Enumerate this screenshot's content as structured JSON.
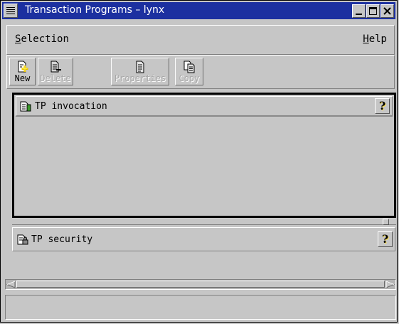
{
  "window": {
    "title": "Transaction Programs – lynx"
  },
  "menubar": {
    "selection": {
      "mnemonic": "S",
      "rest": "election"
    },
    "help": {
      "mnemonic": "H",
      "rest": "elp"
    }
  },
  "toolbar": {
    "buttons": [
      {
        "label": "New",
        "icon": "new-document-icon",
        "enabled": true
      },
      {
        "label": "Delete",
        "icon": "delete-document-icon",
        "enabled": false
      },
      {
        "label": "Properties",
        "icon": "properties-document-icon",
        "enabled": false
      },
      {
        "label": "Copy",
        "icon": "copy-document-icon",
        "enabled": false
      }
    ]
  },
  "panes": {
    "invocation": {
      "title": "TP invocation",
      "help_glyph": "?"
    },
    "security": {
      "title": "TP security",
      "help_glyph": "?"
    }
  },
  "statusbar": {
    "text": ""
  },
  "colors": {
    "titlebar": "#1c30a0",
    "background": "#c6c6c6",
    "help_icon": "#ffe14a"
  }
}
